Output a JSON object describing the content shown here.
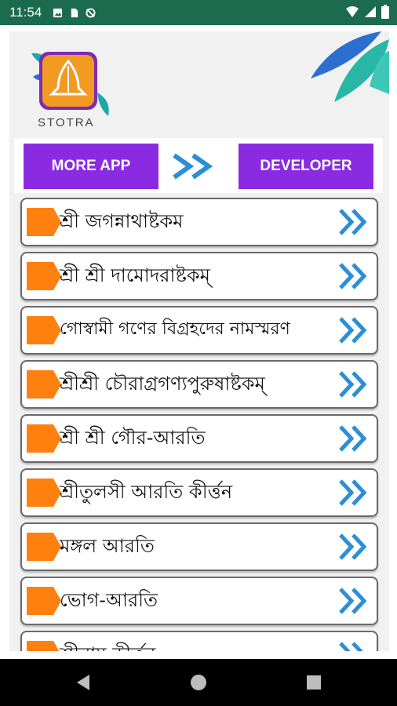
{
  "status_bar": {
    "time": "11:54",
    "left_icons": [
      "image-icon",
      "sim-icon",
      "sync-off-icon"
    ],
    "right_icons": [
      "wifi-icon",
      "signal-icon",
      "battery-icon"
    ]
  },
  "app": {
    "logo_text": "STOTRA",
    "more_app_label": "MORE APP",
    "developer_label": "DEVELOPER"
  },
  "list": {
    "items": [
      {
        "label": "শ্রী জগন্নাথাষ্টকম"
      },
      {
        "label": "শ্রী শ্রী দামোদরাষ্টকম্"
      },
      {
        "label": "গোস্বামী গণের বিগ্রহদের নামস্মরণ"
      },
      {
        "label": "শ্রীশ্রী চৌরাগ্রগণ্যপুরুষাষ্টকম্"
      },
      {
        "label": "শ্রী শ্রী গৌর-আরতি"
      },
      {
        "label": "শ্রীতুলসী আরতি কীর্ত্তন"
      },
      {
        "label": "মঙ্গল আরতি"
      },
      {
        "label": "ভোগ-আরতি"
      },
      {
        "label": "শ্রীনাম কীর্ত্তন"
      }
    ]
  },
  "colors": {
    "status_bar": "#1c6b4f",
    "purple": "#8a2be2",
    "orange": "#ff7f0f",
    "arrow_blue": "#2b8fd6"
  },
  "nav_bar": {
    "icons": [
      "back-icon",
      "home-icon",
      "recents-icon"
    ]
  }
}
